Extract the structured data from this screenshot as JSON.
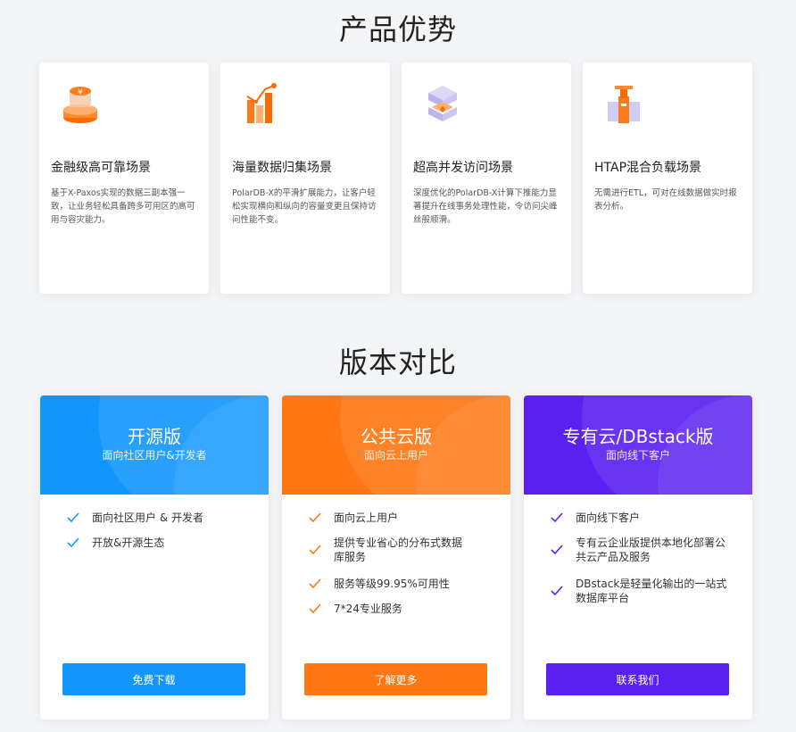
{
  "advantages": {
    "title": "产品优势",
    "cards": [
      {
        "icon": "coin-stack-icon",
        "title": "金融级高可靠场景",
        "desc": "基于X-Paxos实现的数据三副本强一致，让业务轻松具备跨多可用区的高可用与容灾能力。"
      },
      {
        "icon": "bar-chart-growth-icon",
        "title": "海量数据归集场景",
        "desc": "PolarDB-X的平滑扩展能力，让客户轻松实现横向和纵向的容量变更且保持访问性能不变。"
      },
      {
        "icon": "layered-cube-icon",
        "title": "超高并发访问场景",
        "desc": "深度优化的PolarDB-X计算下推能力显著提升在线事务处理性能，令访问尖峰丝般顺滑。"
      },
      {
        "icon": "server-blocks-icon",
        "title": "HTAP混合负载场景",
        "desc": "无需进行ETL，可对在线数据做实时报表分析。"
      }
    ]
  },
  "versions": {
    "title": "版本对比",
    "cards": [
      {
        "name": "开源版",
        "subtitle": "面向社区用户&开发者",
        "color": "#1296fd",
        "features": [
          "面向社区用户 & 开发者",
          "开放&开源生态"
        ],
        "button": "免费下载"
      },
      {
        "name": "公共云版",
        "subtitle": "面向云上用户",
        "color": "#ff7612",
        "features": [
          "面向云上用户",
          "提供专业省心的分布式数据库服务",
          "服务等级99.95%可用性",
          "7*24专业服务"
        ],
        "button": "了解更多"
      },
      {
        "name": "专有云/DBstack版",
        "subtitle": "面向线下客户",
        "color": "#5a20f0",
        "features": [
          "面向线下客户",
          "专有云企业版提供本地化部署公共云产品及服务",
          "DBstack是轻量化输出的一站式数据库平台"
        ],
        "button": "联系我们"
      }
    ]
  }
}
